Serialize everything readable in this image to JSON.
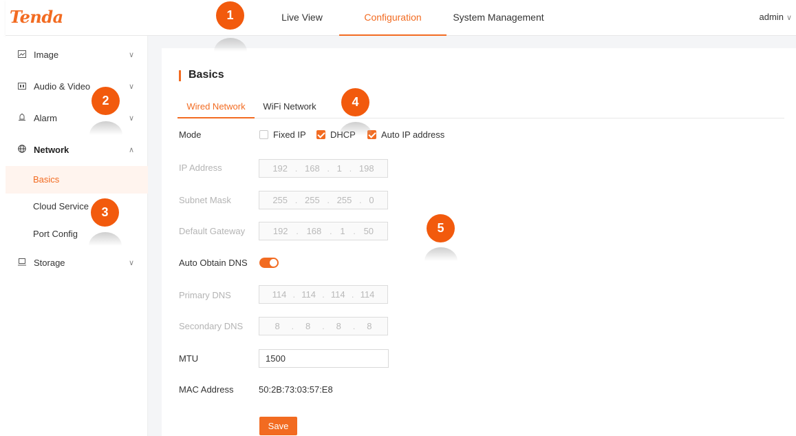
{
  "brand": {
    "logo_text": "Tenda",
    "accent_color": "#f26b21"
  },
  "header": {
    "nav": [
      {
        "label": "Live View",
        "active": false
      },
      {
        "label": "Configuration",
        "active": true
      },
      {
        "label": "System Management",
        "active": false
      }
    ],
    "user": {
      "name": "admin",
      "icon": "chevron-down-icon"
    }
  },
  "sidebar": {
    "groups": [
      {
        "label": "Image",
        "icon": "image-icon",
        "expanded": false
      },
      {
        "label": "Audio & Video",
        "icon": "audio-video-icon",
        "expanded": false
      },
      {
        "label": "Alarm",
        "icon": "alarm-icon",
        "expanded": false
      },
      {
        "label": "Network",
        "icon": "globe-icon",
        "expanded": true,
        "items": [
          {
            "label": "Basics",
            "active": true
          },
          {
            "label": "Cloud Service",
            "active": false
          },
          {
            "label": "Port Config",
            "active": false
          }
        ]
      },
      {
        "label": "Storage",
        "icon": "storage-icon",
        "expanded": false
      }
    ]
  },
  "main": {
    "title": "Basics",
    "tabs": [
      {
        "label": "Wired Network",
        "active": true
      },
      {
        "label": "WiFi Network",
        "active": false
      }
    ],
    "form": {
      "mode": {
        "label": "Mode",
        "options": [
          {
            "label": "Fixed IP",
            "checked": false
          },
          {
            "label": "DHCP",
            "checked": true
          },
          {
            "label": "Auto IP address",
            "checked": true
          }
        ]
      },
      "ip_address": {
        "label": "IP Address",
        "octets": [
          "192",
          "168",
          "1",
          "198"
        ],
        "disabled": true
      },
      "subnet_mask": {
        "label": "Subnet Mask",
        "octets": [
          "255",
          "255",
          "255",
          "0"
        ],
        "disabled": true
      },
      "default_gateway": {
        "label": "Default Gateway",
        "octets": [
          "192",
          "168",
          "1",
          "50"
        ],
        "disabled": true
      },
      "auto_dns": {
        "label": "Auto Obtain DNS",
        "on": true
      },
      "primary_dns": {
        "label": "Primary DNS",
        "octets": [
          "114",
          "114",
          "114",
          "114"
        ],
        "disabled": true
      },
      "secondary_dns": {
        "label": "Secondary DNS",
        "octets": [
          "8",
          "8",
          "8",
          "8"
        ],
        "disabled": true
      },
      "mtu": {
        "label": "MTU",
        "value": "1500"
      },
      "mac": {
        "label": "MAC Address",
        "value": "50:2B:73:03:57:E8"
      }
    },
    "save_label": "Save"
  },
  "callouts": [
    "1",
    "2",
    "3",
    "4",
    "5"
  ]
}
